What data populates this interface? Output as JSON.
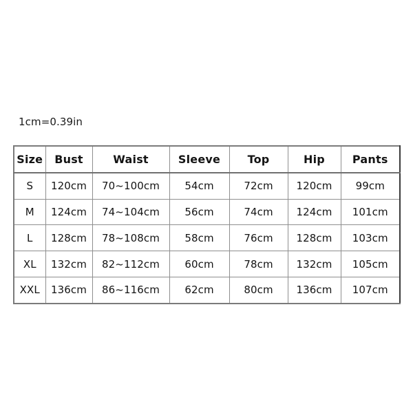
{
  "caption": {
    "conversion_note": "1cm=0.39in"
  },
  "size_table": {
    "columns": [
      "Size",
      "Bust",
      "Waist",
      "Sleeve",
      "Top",
      "Hip",
      "Pants"
    ],
    "rows": [
      {
        "size": "S",
        "bust": "120cm",
        "waist": "70~100cm",
        "sleeve": "54cm",
        "top": "72cm",
        "hip": "120cm",
        "pants": "99cm"
      },
      {
        "size": "M",
        "bust": "124cm",
        "waist": "74~104cm",
        "sleeve": "56cm",
        "top": "74cm",
        "hip": "124cm",
        "pants": "101cm"
      },
      {
        "size": "L",
        "bust": "128cm",
        "waist": "78~108cm",
        "sleeve": "58cm",
        "top": "76cm",
        "hip": "128cm",
        "pants": "103cm"
      },
      {
        "size": "XL",
        "bust": "132cm",
        "waist": "82~112cm",
        "sleeve": "60cm",
        "top": "78cm",
        "hip": "132cm",
        "pants": "105cm"
      },
      {
        "size": "XXL",
        "bust": "136cm",
        "waist": "86~116cm",
        "sleeve": "62cm",
        "top": "80cm",
        "hip": "136cm",
        "pants": "107cm"
      }
    ]
  },
  "colors": {
    "background": "#ffffff",
    "text": "#141414",
    "border": "#8e8e8e",
    "border_outer": "#7a7a7a"
  }
}
